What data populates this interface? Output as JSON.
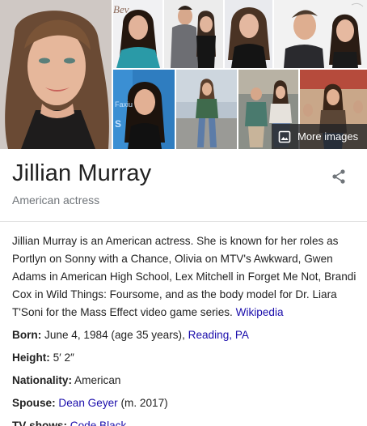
{
  "images": {
    "more_images_label": "More images",
    "photo_watermarks": [
      {
        "tile": 1,
        "text": "Bev"
      },
      {
        "tile": 5,
        "text": "Faxiu"
      },
      {
        "tile": 5,
        "text": "S"
      }
    ]
  },
  "header": {
    "title": "Jillian Murray",
    "subtitle": "American actress"
  },
  "description": {
    "text": "Jillian Murray is an American actress. She is known for her roles as Portlyn on Sonny with a Chance, Olivia on MTV's Awkward, Gwen Adams in American High School, Lex Mitchell in Forget Me Not, Brandi Cox in Wild Things: Foursome, and as the body model for Dr. Liara T'Soni for the Mass Effect video game series.",
    "source_link": "Wikipedia"
  },
  "facts": {
    "born": {
      "label": "Born:",
      "value": "June 4, 1984 (age 35 years),",
      "place_link": "Reading, PA"
    },
    "height": {
      "label": "Height:",
      "value": "5′ 2″"
    },
    "nationality": {
      "label": "Nationality:",
      "value": "American"
    },
    "spouse": {
      "label": "Spouse:",
      "link": "Dean Geyer",
      "suffix": "(m. 2017)"
    },
    "tv_shows": {
      "label": "TV shows:",
      "link": "Code Black"
    }
  },
  "colors": {
    "link": "#1a0dab",
    "muted_text": "#70757a",
    "body_text": "#222222"
  }
}
